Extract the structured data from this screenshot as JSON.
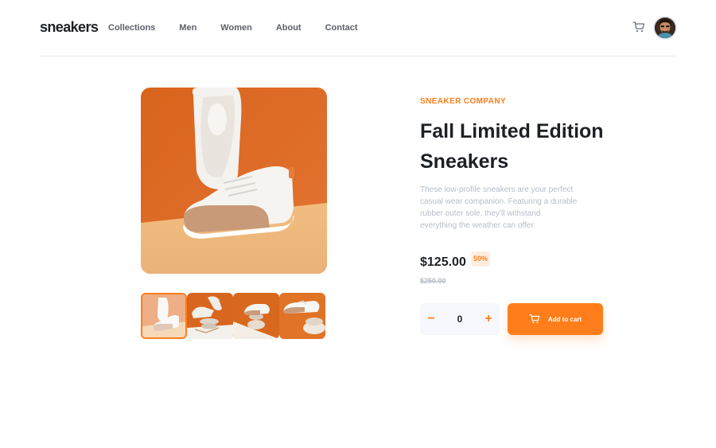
{
  "header": {
    "logo": "sneakers",
    "nav": [
      "Collections",
      "Men",
      "Women",
      "About",
      "Contact"
    ]
  },
  "product": {
    "company": "SNEAKER COMPANY",
    "title": "Fall Limited Edition Sneakers",
    "description": "These low-profile sneakers are your perfect casual wear companion. Featuring a durable rubber outer sole, they'll withstand everything the weather can offer.",
    "price": "$125.00",
    "discount": "50%",
    "old_price": "$250.00"
  },
  "gallery": {
    "thumbnails": [
      "product-1",
      "product-2",
      "product-3",
      "product-4"
    ],
    "active_thumbnail": 1
  },
  "cart": {
    "quantity": "0",
    "minus": "−",
    "plus": "+",
    "add_label": "Add to cart"
  },
  "icons": {
    "cart": "cart-icon",
    "avatar": "user-avatar"
  },
  "colors": {
    "accent": "#ff7e1b",
    "accent_pale": "#ffede0",
    "dark": "#1d2025",
    "muted": "#b6bcc8",
    "light_bg": "#f6f8fd"
  }
}
